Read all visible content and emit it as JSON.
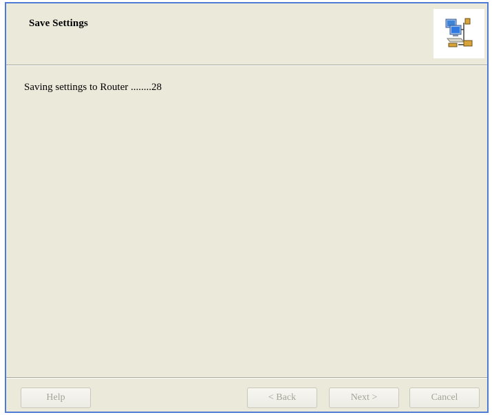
{
  "wizard": {
    "title": "Save Settings",
    "icon": "network-computers-icon",
    "status_text": "Saving settings to Router ........28",
    "buttons": {
      "help": "Help",
      "back": "< Back",
      "next": "Next >",
      "cancel": "Cancel"
    }
  },
  "colors": {
    "border": "#4d7bd3",
    "background": "#ebe9da",
    "disabled_text": "#a6a397"
  }
}
